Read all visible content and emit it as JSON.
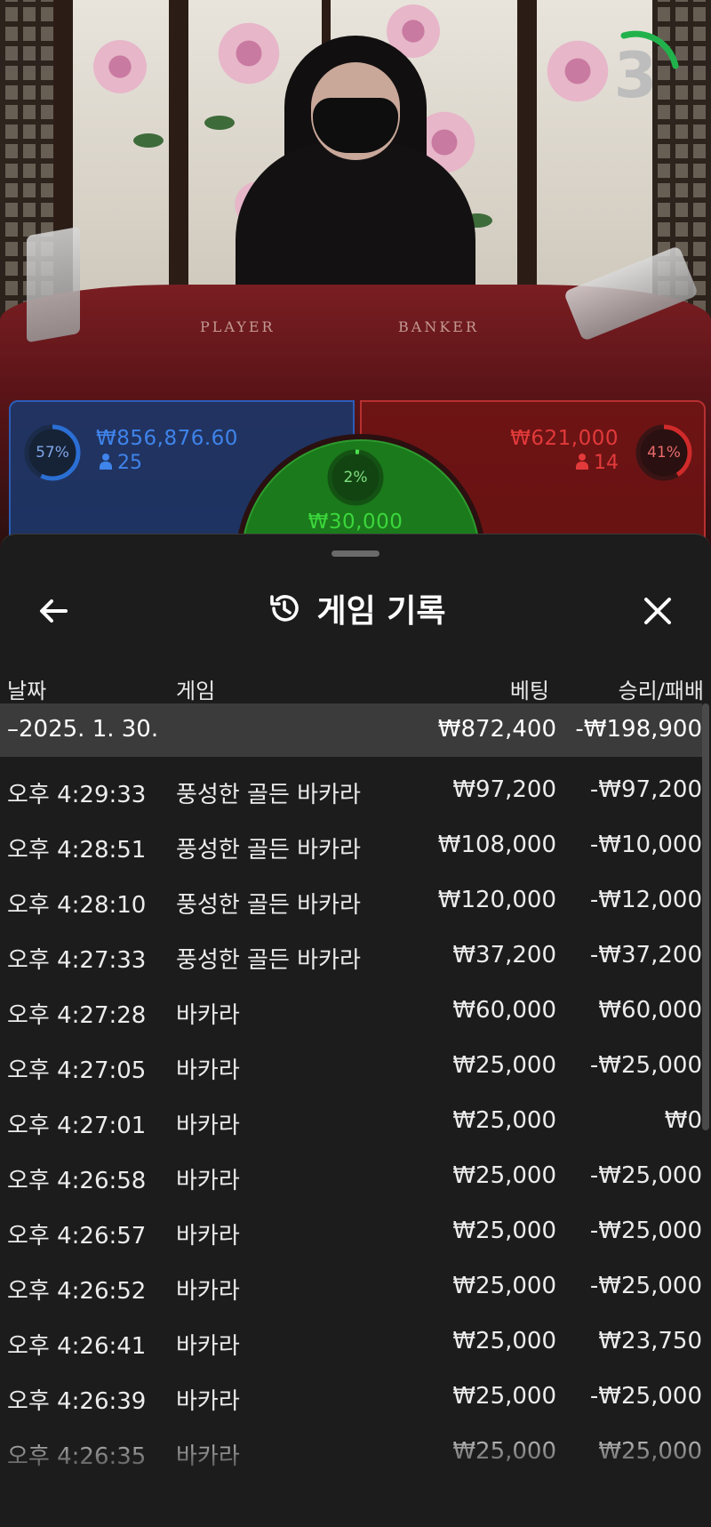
{
  "live_table": {
    "timer": "3",
    "felt_labels": {
      "player": "PLAYER",
      "banker": "BANKER"
    },
    "player_spot": {
      "percent": "57%",
      "percent_value": 57,
      "amount": "₩856,876.60",
      "players": "25"
    },
    "tie_spot": {
      "percent": "2%",
      "percent_value": 2,
      "amount": "₩30,000"
    },
    "banker_spot": {
      "percent": "41%",
      "percent_value": 41,
      "amount": "₩621,000",
      "players": "14"
    },
    "colors": {
      "player": "#2b6fd4",
      "banker": "#d12a2a",
      "tie": "#2cc22c",
      "timer_arc": "#22b24c"
    }
  },
  "history": {
    "title": "게임 기록",
    "icons": {
      "back": "arrow-left-icon",
      "title": "history-icon",
      "close": "close-icon"
    },
    "columns": {
      "date": "날짜",
      "game": "게임",
      "bet": "베팅",
      "result": "승리/패배"
    },
    "day_group": {
      "date": "–2025. 1. 30.",
      "total_bet": "₩872,400",
      "total_result": "-₩198,900"
    },
    "rows": [
      {
        "time": "오후 4:29:33",
        "game": "풍성한 골든 바카라",
        "bet": "₩97,200",
        "result": "-₩97,200"
      },
      {
        "time": "오후 4:28:51",
        "game": "풍성한 골든 바카라",
        "bet": "₩108,000",
        "result": "-₩10,000"
      },
      {
        "time": "오후 4:28:10",
        "game": "풍성한 골든 바카라",
        "bet": "₩120,000",
        "result": "-₩12,000"
      },
      {
        "time": "오후 4:27:33",
        "game": "풍성한 골든 바카라",
        "bet": "₩37,200",
        "result": "-₩37,200"
      },
      {
        "time": "오후 4:27:28",
        "game": "바카라",
        "bet": "₩60,000",
        "result": "₩60,000"
      },
      {
        "time": "오후 4:27:05",
        "game": "바카라",
        "bet": "₩25,000",
        "result": "-₩25,000"
      },
      {
        "time": "오후 4:27:01",
        "game": "바카라",
        "bet": "₩25,000",
        "result": "₩0"
      },
      {
        "time": "오후 4:26:58",
        "game": "바카라",
        "bet": "₩25,000",
        "result": "-₩25,000"
      },
      {
        "time": "오후 4:26:57",
        "game": "바카라",
        "bet": "₩25,000",
        "result": "-₩25,000"
      },
      {
        "time": "오후 4:26:52",
        "game": "바카라",
        "bet": "₩25,000",
        "result": "-₩25,000"
      },
      {
        "time": "오후 4:26:41",
        "game": "바카라",
        "bet": "₩25,000",
        "result": "₩23,750"
      },
      {
        "time": "오후 4:26:39",
        "game": "바카라",
        "bet": "₩25,000",
        "result": "-₩25,000"
      },
      {
        "time": "오후 4:26:35",
        "game": "바카라",
        "bet": "₩25,000",
        "result": "₩25,000"
      }
    ]
  }
}
